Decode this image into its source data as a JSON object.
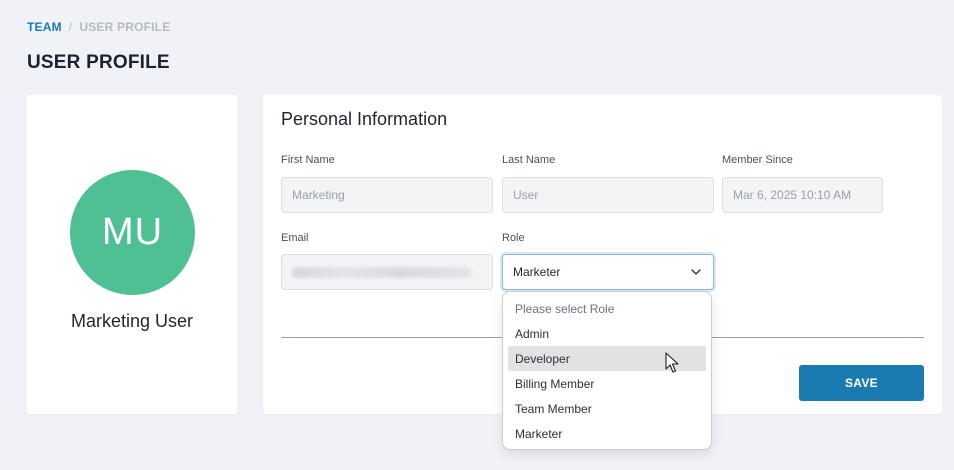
{
  "breadcrumb": {
    "link": "TEAM",
    "separator": "/",
    "current": "USER PROFILE"
  },
  "page_title": "USER PROFILE",
  "profile": {
    "initials": "MU",
    "name": "Marketing User",
    "avatar_color": "#4fbf94"
  },
  "personal_info": {
    "title": "Personal Information",
    "first_name": {
      "label": "First Name",
      "value": "Marketing"
    },
    "last_name": {
      "label": "Last Name",
      "value": "User"
    },
    "member_since": {
      "label": "Member Since",
      "value": "Mar 6, 2025 10:10 AM"
    },
    "email": {
      "label": "Email",
      "value": ""
    },
    "role": {
      "label": "Role",
      "value": "Marketer"
    }
  },
  "role_dropdown": {
    "options": [
      "Please select Role",
      "Admin",
      "Developer",
      "Billing Member",
      "Team Member",
      "Marketer"
    ],
    "hovered": "Developer"
  },
  "save_label": "SAVE",
  "colors": {
    "accent": "#1a7bb0",
    "avatar": "#4fbf94",
    "background": "#f0f2f7"
  },
  "icons": {
    "role_chevron": "chevron-down-icon",
    "pointer": "mouse-pointer-icon"
  }
}
